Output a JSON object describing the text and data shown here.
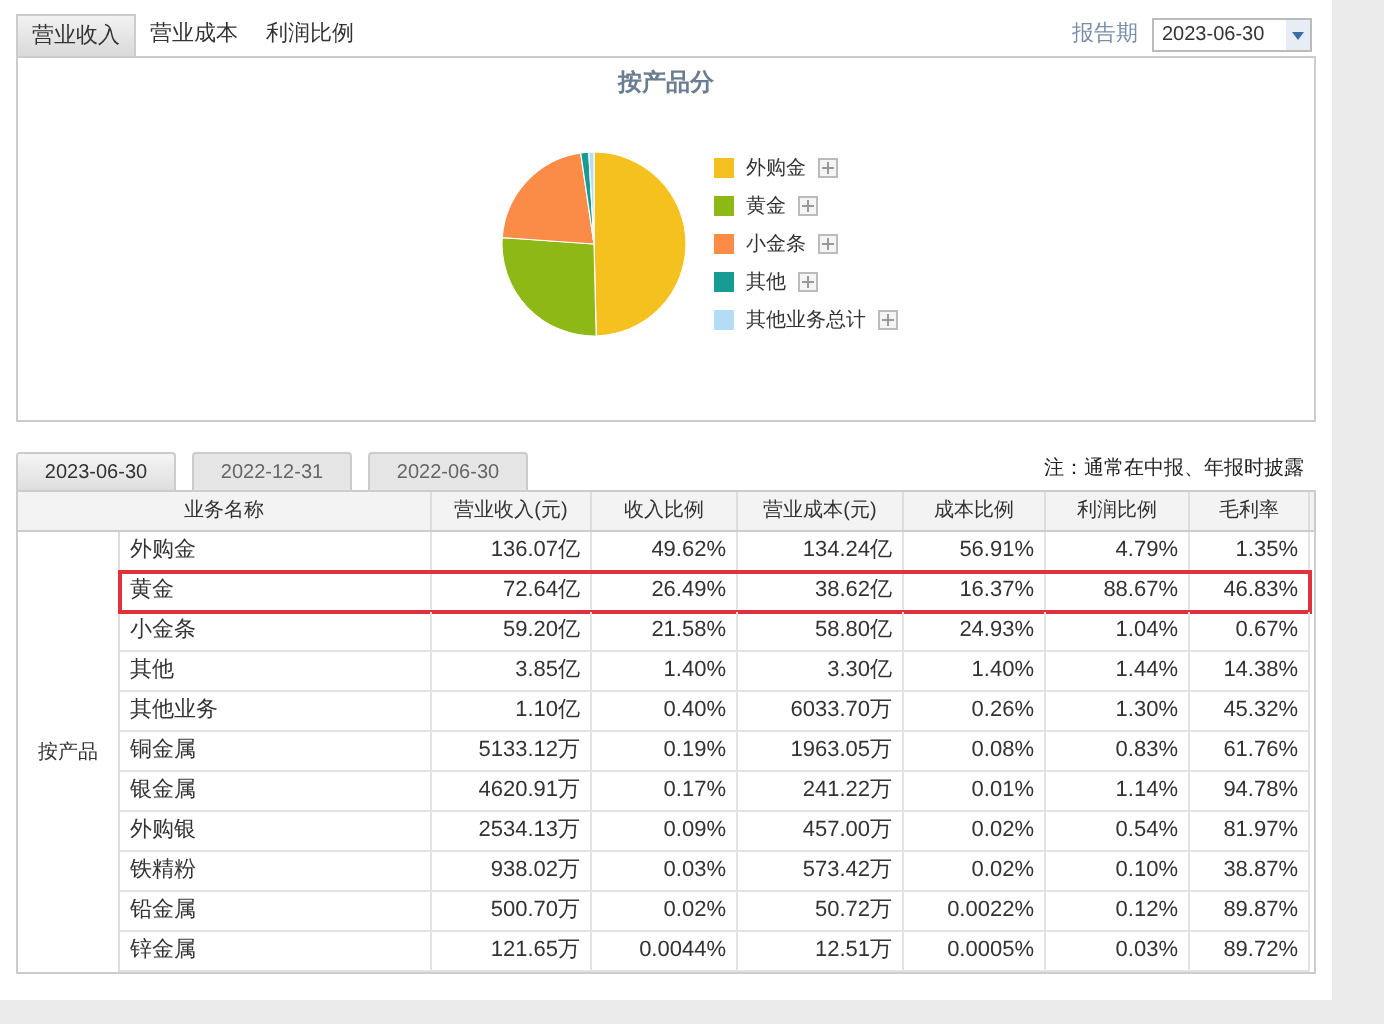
{
  "top_tabs": [
    {
      "label": "营业收入",
      "selected": true
    },
    {
      "label": "营业成本",
      "selected": false
    },
    {
      "label": "利润比例",
      "selected": false
    }
  ],
  "period": {
    "label": "报告期",
    "value": "2023-06-30"
  },
  "chart": {
    "chart_data": {
      "type": "pie",
      "title": "按产品分",
      "categories": [
        "外购金",
        "黄金",
        "小金条",
        "其他",
        "其他业务总计"
      ],
      "series": [
        {
          "values": [
            49.62,
            26.49,
            21.58,
            1.4,
            0.91
          ]
        }
      ],
      "legend": "right",
      "colors": [
        "#f5c11f",
        "#8db816",
        "#fb8c48",
        "#179c93",
        "#b5dcf6"
      ]
    }
  },
  "date_tabs": [
    {
      "label": "2023-06-30",
      "selected": true
    },
    {
      "label": "2022-12-31",
      "selected": false
    },
    {
      "label": "2022-06-30",
      "selected": false
    }
  ],
  "note": "注：通常在中报、年报时披露",
  "table": {
    "columns": [
      "业务名称",
      "营业收入(元)",
      "收入比例",
      "营业成本(元)",
      "成本比例",
      "利润比例",
      "毛利率"
    ],
    "group": "按产品",
    "rows": [
      {
        "cells": [
          "外购金",
          "136.07亿",
          "49.62%",
          "134.24亿",
          "56.91%",
          "4.79%",
          "1.35%"
        ],
        "highlighted": false
      },
      {
        "cells": [
          "黄金",
          "72.64亿",
          "26.49%",
          "38.62亿",
          "16.37%",
          "88.67%",
          "46.83%"
        ],
        "highlighted": true
      },
      {
        "cells": [
          "小金条",
          "59.20亿",
          "21.58%",
          "58.80亿",
          "24.93%",
          "1.04%",
          "0.67%"
        ],
        "highlighted": false
      },
      {
        "cells": [
          "其他",
          "3.85亿",
          "1.40%",
          "3.30亿",
          "1.40%",
          "1.44%",
          "14.38%"
        ],
        "highlighted": false
      },
      {
        "cells": [
          "其他业务",
          "1.10亿",
          "0.40%",
          "6033.70万",
          "0.26%",
          "1.30%",
          "45.32%"
        ],
        "highlighted": false
      },
      {
        "cells": [
          "铜金属",
          "5133.12万",
          "0.19%",
          "1963.05万",
          "0.08%",
          "0.83%",
          "61.76%"
        ],
        "highlighted": false
      },
      {
        "cells": [
          "银金属",
          "4620.91万",
          "0.17%",
          "241.22万",
          "0.01%",
          "1.14%",
          "94.78%"
        ],
        "highlighted": false
      },
      {
        "cells": [
          "外购银",
          "2534.13万",
          "0.09%",
          "457.00万",
          "0.02%",
          "0.54%",
          "81.97%"
        ],
        "highlighted": false
      },
      {
        "cells": [
          "铁精粉",
          "938.02万",
          "0.03%",
          "573.42万",
          "0.02%",
          "0.10%",
          "38.87%"
        ],
        "highlighted": false
      },
      {
        "cells": [
          "铅金属",
          "500.70万",
          "0.02%",
          "50.72万",
          "0.0022%",
          "0.12%",
          "89.87%"
        ],
        "highlighted": false
      },
      {
        "cells": [
          "锌金属",
          "121.65万",
          "0.0044%",
          "12.51万",
          "0.0005%",
          "0.03%",
          "89.72%"
        ],
        "highlighted": false
      }
    ]
  }
}
